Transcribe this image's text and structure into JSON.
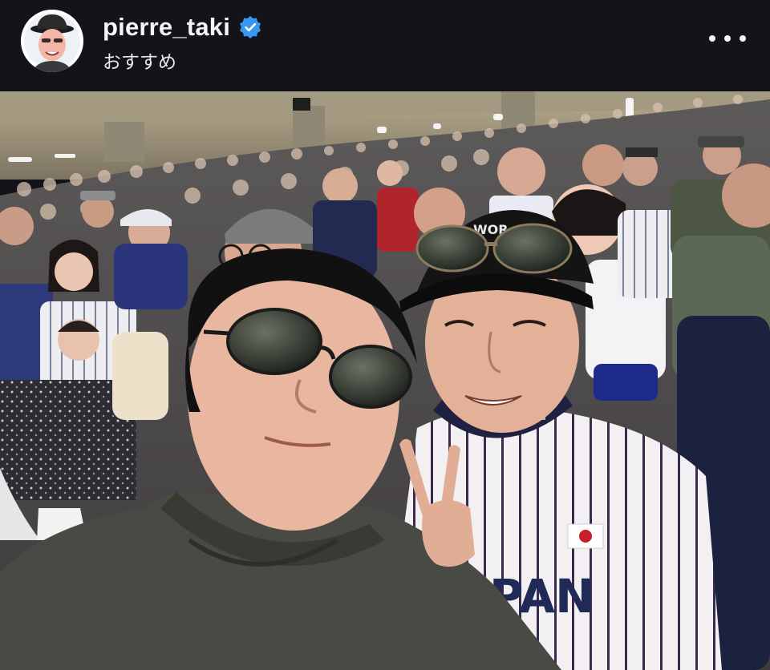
{
  "header": {
    "username": "pierre_taki",
    "subtitle": "おすすめ",
    "verified": true,
    "more_menu_icon": "more-horizontal-icon"
  },
  "avatar": {
    "icon": "profile-avatar-illustration"
  },
  "colors": {
    "header_background": "#12141a",
    "verified_blue": "#3897f0",
    "text_primary": "#f5f5f5"
  },
  "photo": {
    "jersey_text": "PAN",
    "cap_text": "WOR"
  }
}
